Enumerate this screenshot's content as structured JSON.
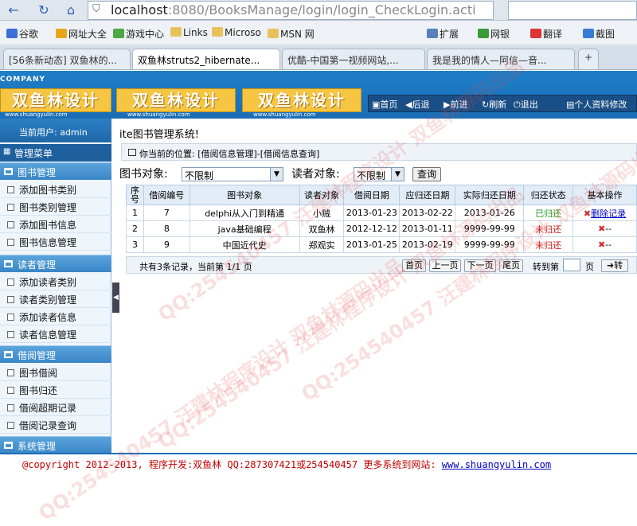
{
  "browser": {
    "url_host": "localhost",
    "url_rest": ":8080/BooksManage/login/login_CheckLogin.acti",
    "bookmarks": [
      "谷歌",
      "网址大全",
      "游戏中心",
      "Links",
      "Microso",
      "MSN 网",
      "扩展",
      "网银",
      "翻译",
      "截图"
    ],
    "tabs": [
      {
        "label": "[56条新动态] 双鱼林的..."
      },
      {
        "label": "双鱼林struts2_hibernate..."
      },
      {
        "label": "优酷-中国第一视频网站,..."
      },
      {
        "label": "我是我的情人—阿信—音..."
      }
    ]
  },
  "header": {
    "company": "COMPANY",
    "logo_text": "双鱼林设计",
    "logo_sub": "www.shuangyulin.com",
    "nav": [
      "首页",
      "后退",
      "前进",
      "刷新",
      "退出",
      "个人资料修改"
    ]
  },
  "sidebar": {
    "user_label": "当前用户: admin",
    "menu_title": "管理菜单",
    "groups": [
      {
        "title": "图书管理",
        "items": [
          "添加图书类别",
          "图书类别管理",
          "添加图书信息",
          "图书信息管理"
        ]
      },
      {
        "title": "读者管理",
        "items": [
          "添加读者类别",
          "读者类别管理",
          "添加读者信息",
          "读者信息管理"
        ]
      },
      {
        "title": "借阅管理",
        "items": [
          "图书借阅",
          "图书归还",
          "借阅超期记录",
          "借阅记录查询"
        ]
      },
      {
        "title": "系统管理",
        "items": []
      }
    ]
  },
  "main": {
    "system_title": "ite图书管理系统!",
    "location": "你当前的位置: [借阅信息管理]-[借阅信息查询]",
    "filter": {
      "book_label": "图书对象:",
      "book_value": "不限制",
      "reader_label": "读者对象:",
      "reader_value": "不限制",
      "query_button": "查询"
    },
    "table": {
      "headers": [
        "序号",
        "借阅编号",
        "图书对象",
        "读者对象",
        "借阅日期",
        "应归还日期",
        "实际归还日期",
        "归还状态",
        "基本操作"
      ],
      "rows": [
        [
          "1",
          "7",
          "delphi从入门到精通",
          "小贼",
          "2013-01-23",
          "2013-02-22",
          "2013-01-26",
          "已归还",
          "删除记录"
        ],
        [
          "2",
          "8",
          "java基础编程",
          "双鱼林",
          "2012-12-12",
          "2013-01-11",
          "9999-99-99",
          "未归还",
          "--"
        ],
        [
          "3",
          "9",
          "中国近代史",
          "郑观实",
          "2013-01-25",
          "2013-02-19",
          "9999-99-99",
          "未归还",
          "--"
        ]
      ]
    },
    "pager": {
      "summary": "共有3条记录，当前第 1/1 页",
      "first": "首页",
      "prev": "上一页",
      "next": "下一页",
      "last": "尾页",
      "goto_label": "转到第",
      "page_unit": "页",
      "go": "转"
    }
  },
  "footer": {
    "text": "@copyright 2012-2013, 程序开发:双鱼林  QQ:287307421或254540457  更多系统到网站: ",
    "site": "www.shuangyulin.com"
  },
  "watermark": "QQ:254540457 汪建林程序设计 双鱼林源码出品"
}
